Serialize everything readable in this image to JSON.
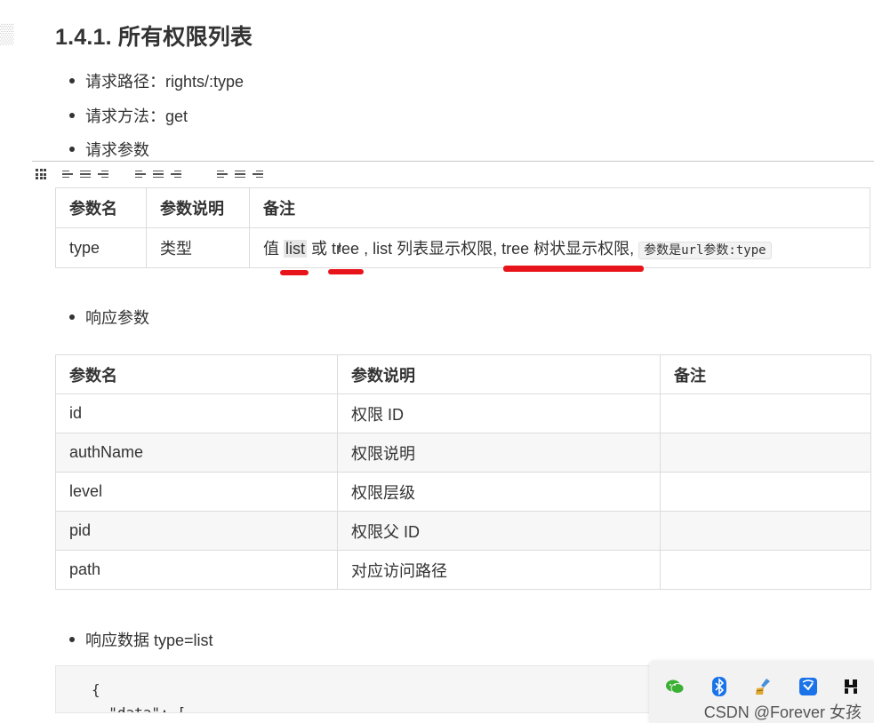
{
  "heading": "1.4.1. 所有权限列表",
  "bullets": {
    "path": "请求路径：rights/:type",
    "method": "请求方法：get",
    "params": "请求参数",
    "response_params": "响应参数",
    "response_data": "响应数据 type=list"
  },
  "request_table": {
    "headers": [
      "参数名",
      "参数说明",
      "备注"
    ],
    "row": {
      "name": "type",
      "desc": "类型",
      "note_prefix": "值",
      "note_list": "list",
      "note_or": "或",
      "note_tree_a": "tr",
      "note_tree_b": "ee",
      "note_rest": " , list 列表显示权限, tree 树状显示权限,",
      "note_code": "参数是url参数:type"
    }
  },
  "response_table": {
    "headers": [
      "参数名",
      "参数说明",
      "备注"
    ],
    "rows": [
      {
        "name": "id",
        "desc": "权限 ID",
        "note": ""
      },
      {
        "name": "authName",
        "desc": "权限说明",
        "note": ""
      },
      {
        "name": "level",
        "desc": "权限层级",
        "note": ""
      },
      {
        "name": "pid",
        "desc": "权限父 ID",
        "note": ""
      },
      {
        "name": "path",
        "desc": "对应访问路径",
        "note": ""
      }
    ]
  },
  "code": {
    "line1": "{",
    "line2": "  \"data\": ["
  },
  "watermark": "CSDN @Forever  女孩",
  "tray_icons": [
    "wechat-icon",
    "bluetooth-icon",
    "cleaner-icon",
    "app-icon",
    "scissors-icon"
  ],
  "colors": {
    "underline": "#e8141b",
    "bluetooth": "#1a73e8",
    "wechat": "#3cb034"
  }
}
